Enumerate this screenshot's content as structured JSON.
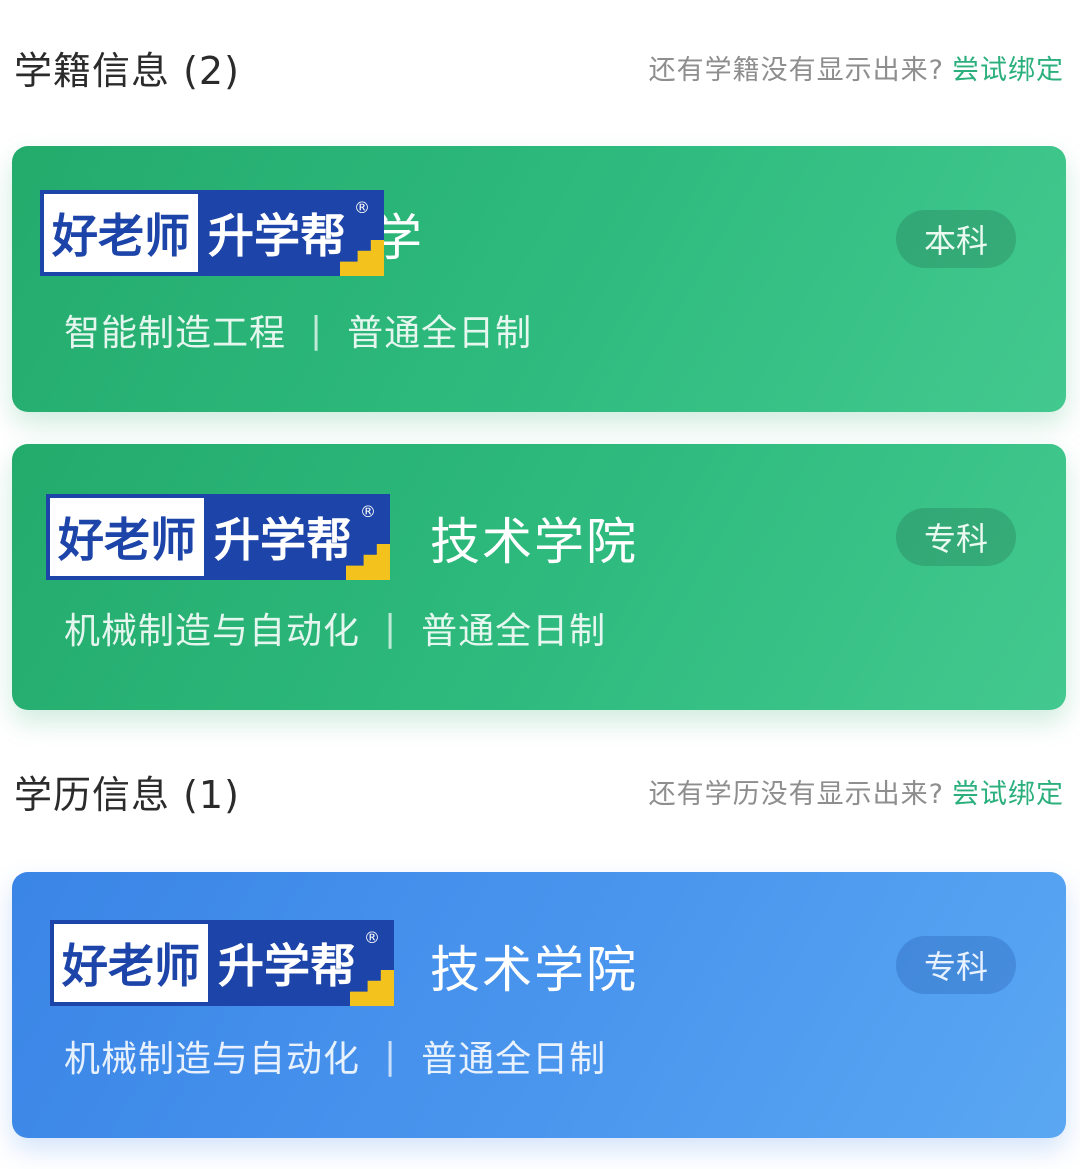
{
  "enrollment": {
    "title": "学籍信息 (2)",
    "hint": "还有学籍没有显示出来?",
    "link": "尝试绑定",
    "cards": [
      {
        "school": "学",
        "major": "智能制造工程",
        "separator": "|",
        "study_mode": "普通全日制",
        "level": "本科"
      },
      {
        "school": "技术学院",
        "major": "机械制造与自动化",
        "separator": "|",
        "study_mode": "普通全日制",
        "level": "专科"
      }
    ]
  },
  "education": {
    "title": "学历信息 (1)",
    "hint": "还有学历没有显示出来?",
    "link": "尝试绑定",
    "cards": [
      {
        "school": "技术学院",
        "major": "机械制造与自动化",
        "separator": "|",
        "study_mode": "普通全日制",
        "level": "专科"
      }
    ]
  },
  "watermark": {
    "part1": "好老师",
    "part2": "升学帮",
    "reg": "®"
  },
  "colors": {
    "green_card": "#2fb87a",
    "blue_card": "#4a94ec",
    "link": "#2bb07d",
    "watermark_blue": "#1d44a8",
    "watermark_yellow": "#f4c21c"
  }
}
